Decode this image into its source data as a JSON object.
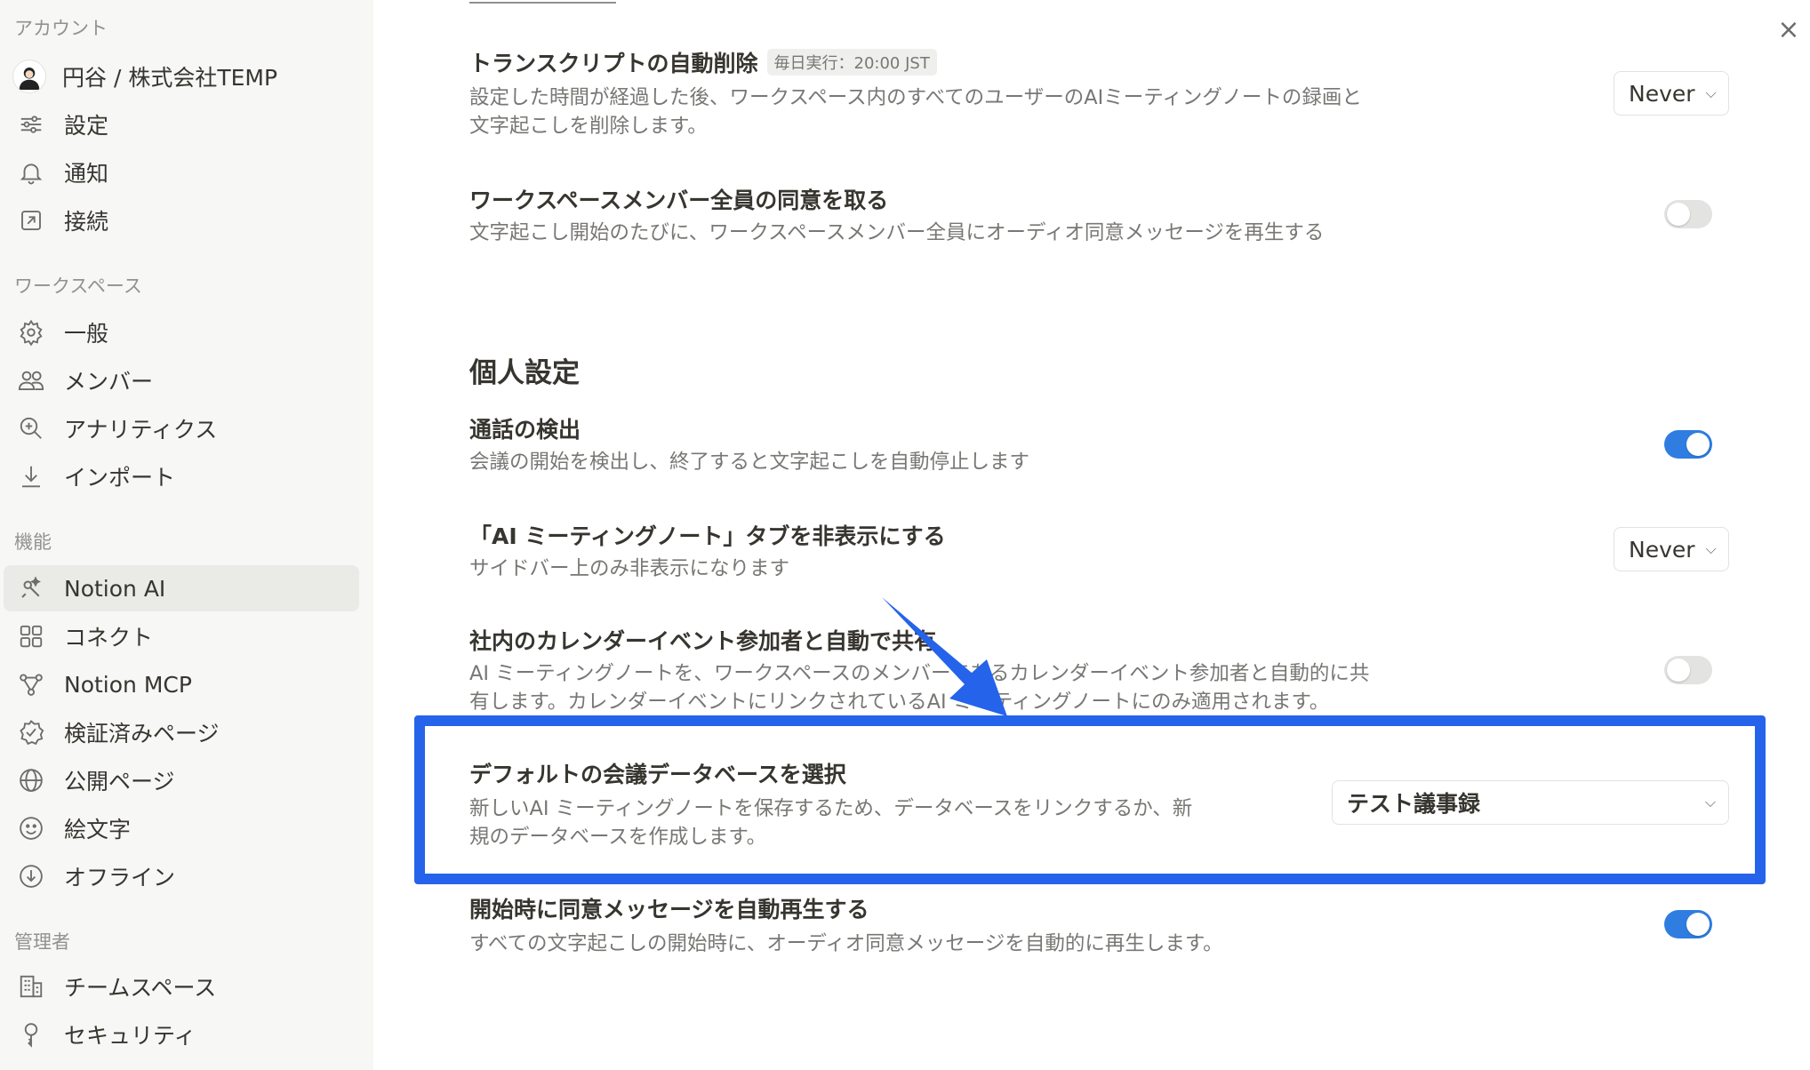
{
  "sidebar": {
    "sections": {
      "account": "アカウント",
      "workspace": "ワークスペース",
      "features": "機能",
      "admin": "管理者"
    },
    "account_items": [
      {
        "label": "円谷 / 株式会社TEMP",
        "icon": "user-avatar"
      },
      {
        "label": "設定",
        "icon": "sliders-icon"
      },
      {
        "label": "通知",
        "icon": "bell-icon"
      },
      {
        "label": "接続",
        "icon": "external-link-icon"
      }
    ],
    "workspace_items": [
      {
        "label": "一般",
        "icon": "gear-icon"
      },
      {
        "label": "メンバー",
        "icon": "people-icon"
      },
      {
        "label": "アナリティクス",
        "icon": "zoom-in-icon"
      },
      {
        "label": "インポート",
        "icon": "download-icon"
      }
    ],
    "feature_items": [
      {
        "label": "Notion AI",
        "icon": "notion-ai-icon",
        "active": true
      },
      {
        "label": "コネクト",
        "icon": "grid-icon"
      },
      {
        "label": "Notion MCP",
        "icon": "network-icon"
      },
      {
        "label": "検証済みページ",
        "icon": "verified-badge-icon"
      },
      {
        "label": "公開ページ",
        "icon": "globe-icon"
      },
      {
        "label": "絵文字",
        "icon": "smiley-icon"
      },
      {
        "label": "オフライン",
        "icon": "offline-download-icon"
      }
    ],
    "admin_items": [
      {
        "label": "チームスペース",
        "icon": "building-icon"
      },
      {
        "label": "セキュリティ",
        "icon": "key-icon"
      }
    ]
  },
  "main": {
    "transcript_delete": {
      "title": "トランスクリプトの自動削除",
      "badge": "毎日実行：20:00 JST",
      "desc_line1": "設定した時間が経過した後、ワークスペース内のすべてのユーザーのAIミーティングノートの録画と",
      "desc_line2": "文字起こしを削除します。",
      "select_value": "Never"
    },
    "member_consent": {
      "title": "ワークスペースメンバー全員の同意を取る",
      "desc": "文字起こし開始のたびに、ワークスペースメンバー全員にオーディオ同意メッセージを再生する",
      "toggle": "off"
    },
    "personal_heading": "個人設定",
    "call_detect": {
      "title": "通話の検出",
      "desc": "会議の開始を検出し、終了すると文字起こしを自動停止します",
      "toggle": "on"
    },
    "hide_tab": {
      "title": "「AI ミーティングノート」タブを非表示にする",
      "desc": "サイドバー上のみ非表示になります",
      "select_value": "Never"
    },
    "calendar_share": {
      "title": "社内のカレンダーイベント参加者と自動で共有",
      "desc_line1": "AI ミーティングノートを、ワークスペースのメンバーであるカレンダーイベント参加者と自動的に共",
      "desc_line2": "有します。カレンダーイベントにリンクされているAI ミーティングノートにのみ適用されます。",
      "toggle": "off"
    },
    "default_db": {
      "title": "デフォルトの会議データベースを選択",
      "desc_line1": "新しいAI ミーティングノートを保存するため、データベースをリンクするか、新",
      "desc_line2": "規のデータベースを作成します。",
      "select_value": "テスト議事録"
    },
    "auto_consent": {
      "title": "開始時に同意メッセージを自動再生する",
      "desc": "すべての文字起こしの開始時に、オーディオ同意メッセージを自動的に再生します。",
      "toggle": "on"
    }
  },
  "colors": {
    "accent": "#2f7de1",
    "annotation": "#2563eb",
    "sidebar_bg": "#f7f7f5"
  }
}
